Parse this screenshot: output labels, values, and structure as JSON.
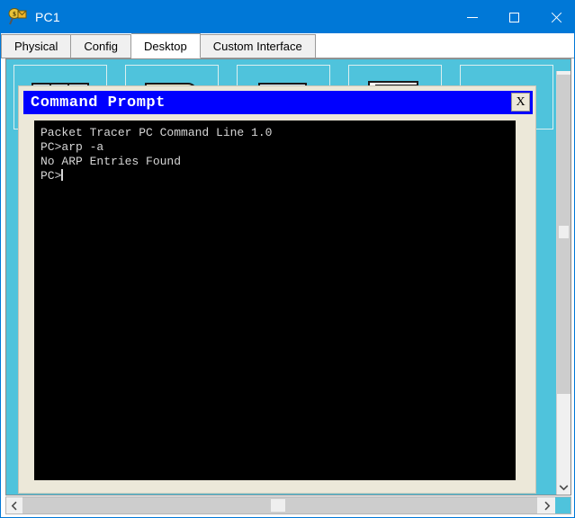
{
  "window": {
    "title": "PC1",
    "icon": "packet-tracer-pc-icon",
    "controls": {
      "minimize": "minimize-icon",
      "maximize": "maximize-icon",
      "close": "close-icon"
    }
  },
  "tabs": [
    {
      "label": "Physical",
      "active": false
    },
    {
      "label": "Config",
      "active": false
    },
    {
      "label": "Desktop",
      "active": true
    },
    {
      "label": "Custom Interface",
      "active": false
    }
  ],
  "desktop": {
    "background_color": "#4FC3DC",
    "icons": [
      {
        "name": "command-prompt-icon"
      },
      {
        "name": "document-icon"
      },
      {
        "name": "window-icon"
      },
      {
        "name": "monitor-icon"
      },
      {
        "name": "globe-icon"
      }
    ]
  },
  "command_prompt": {
    "title": "Command Prompt",
    "close_label": "X",
    "titlebar_color": "#0000FF",
    "terminal_background": "#000000",
    "terminal_text_color": "#D6D6D6",
    "lines": [
      "Packet Tracer PC Command Line 1.0",
      "PC>arp -a",
      "No ARP Entries Found",
      "PC>"
    ]
  },
  "scrollbars": {
    "vertical": {
      "up_arrow": "chevron-up-icon",
      "down_arrow": "chevron-down-icon"
    },
    "horizontal": {
      "left_arrow": "chevron-left-icon",
      "right_arrow": "chevron-right-icon"
    }
  }
}
